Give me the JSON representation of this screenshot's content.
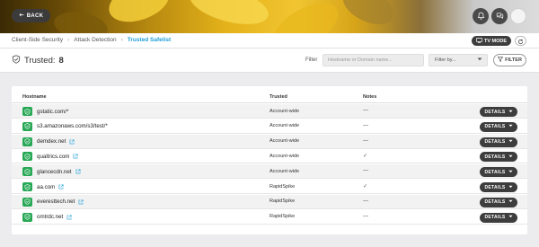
{
  "header": {
    "back_label": "BACK",
    "icons": [
      "bell-icon",
      "chat-icon",
      "avatar"
    ]
  },
  "breadcrumb": {
    "items": [
      "Client-Side Security",
      "Attack Detection",
      "Trusted Safelist"
    ],
    "separator": "›",
    "tv_mode_label": "TV MODE"
  },
  "toolbar": {
    "title": "Trusted:",
    "count": "8",
    "filter_label": "Filter",
    "search_placeholder": "Hostname or Domain name...",
    "filter_by_label": "Filter by...",
    "filter_button_label": "FILTER"
  },
  "table": {
    "columns": {
      "hostname": "Hostname",
      "trusted": "Trusted",
      "notes": "Notes"
    },
    "details_label": "DETAILS",
    "rows": [
      {
        "hostname": "gstatic.com/*",
        "external_link": false,
        "trusted": "Account-wide",
        "notes": "—"
      },
      {
        "hostname": "s3.amazonaws.com/s3/test/*",
        "external_link": false,
        "trusted": "Account-wide",
        "notes": "—"
      },
      {
        "hostname": "demdex.net",
        "external_link": true,
        "trusted": "Account-wide",
        "notes": "—"
      },
      {
        "hostname": "qualtrics.com",
        "external_link": true,
        "trusted": "Account-wide",
        "notes": "✓"
      },
      {
        "hostname": "glancecdn.net",
        "external_link": true,
        "trusted": "Account-wide",
        "notes": "—"
      },
      {
        "hostname": "aa.com",
        "external_link": true,
        "trusted": "RapidSpike",
        "notes": "✓"
      },
      {
        "hostname": "everesttech.net",
        "external_link": true,
        "trusted": "RapidSpike",
        "notes": "—"
      },
      {
        "hostname": "omtrdc.net",
        "external_link": true,
        "trusted": "RapidSpike",
        "notes": "—"
      }
    ]
  },
  "colors": {
    "accent": "#1e9fd6",
    "trusted_green": "#27a855",
    "dark_button": "#3d3d3d"
  }
}
